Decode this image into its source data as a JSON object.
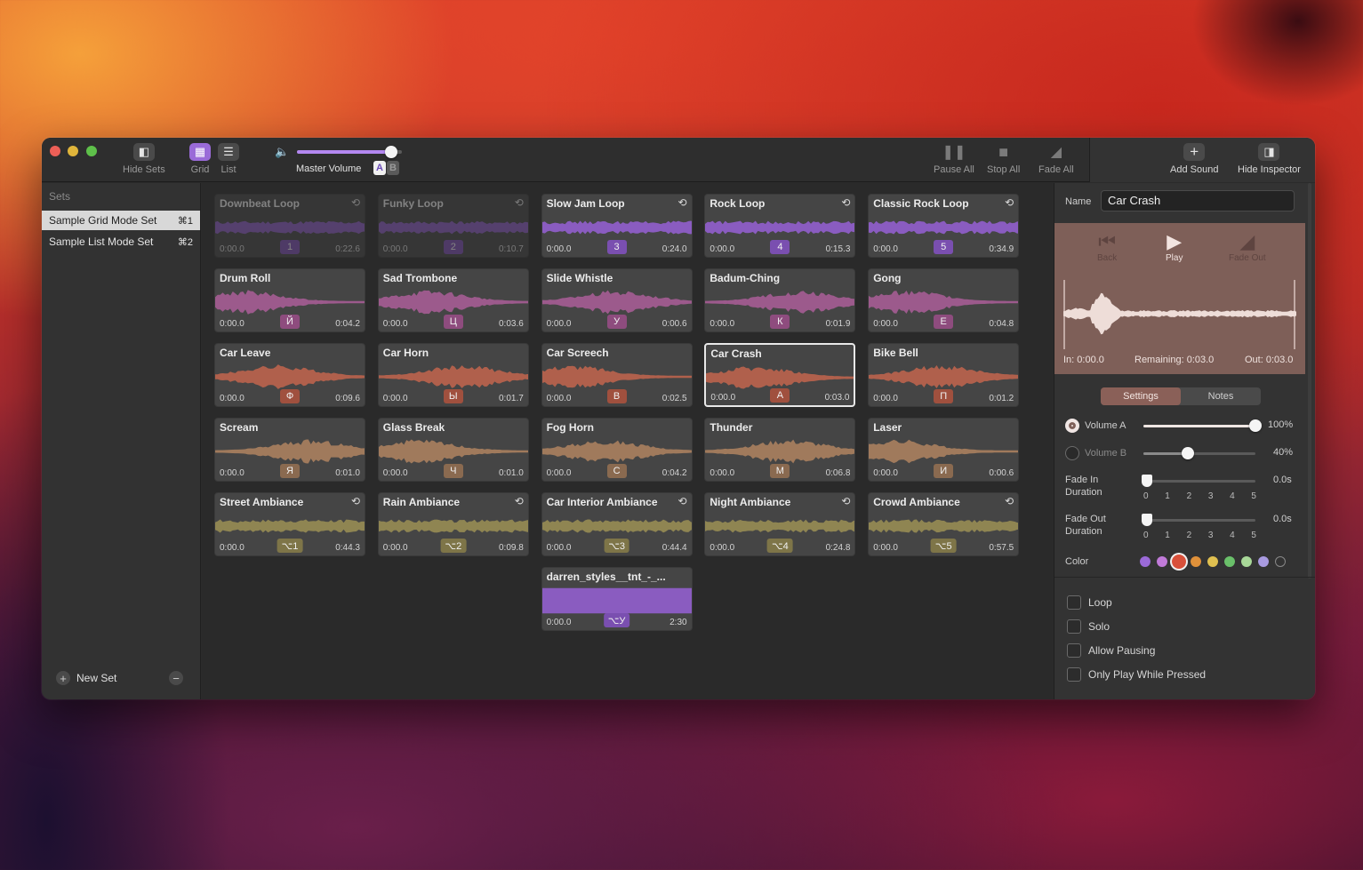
{
  "toolbar": {
    "hide_sets": "Hide Sets",
    "grid": "Grid",
    "list": "List",
    "master_volume": "Master Volume",
    "volume_level": 0.9,
    "ab_a": "A",
    "ab_b": "B",
    "pause_all": "Pause All",
    "stop_all": "Stop All",
    "fade_all": "Fade All",
    "add_sound": "Add Sound",
    "hide_inspector": "Hide Inspector"
  },
  "sidebar": {
    "heading": "Sets",
    "sets": [
      {
        "name": "Sample Grid Mode Set",
        "shortcut": "⌘1",
        "selected": true
      },
      {
        "name": "Sample List Mode Set",
        "shortcut": "⌘2",
        "selected": false
      }
    ],
    "new_set": "New Set"
  },
  "colors": {
    "purple": "#8a5cc0",
    "pink": "#9c5a8c",
    "salmon": "#b0604c",
    "tan": "#a07a5c",
    "olive": "#8f8552"
  },
  "tiles": [
    {
      "title": "Downbeat Loop",
      "key": "1",
      "start": "0:00.0",
      "end": "0:22.6",
      "loop": true,
      "color": "purple",
      "dim": true
    },
    {
      "title": "Funky Loop",
      "key": "2",
      "start": "0:00.0",
      "end": "0:10.7",
      "loop": true,
      "color": "purple",
      "dim": true
    },
    {
      "title": "Slow Jam Loop",
      "key": "3",
      "start": "0:00.0",
      "end": "0:24.0",
      "loop": true,
      "color": "purple"
    },
    {
      "title": "Rock Loop",
      "key": "4",
      "start": "0:00.0",
      "end": "0:15.3",
      "loop": true,
      "color": "purple"
    },
    {
      "title": "Classic Rock Loop",
      "key": "5",
      "start": "0:00.0",
      "end": "0:34.9",
      "loop": true,
      "color": "purple"
    },
    {
      "title": "Drum Roll",
      "key": "Й",
      "start": "0:00.0",
      "end": "0:04.2",
      "color": "pink"
    },
    {
      "title": "Sad Trombone",
      "key": "Ц",
      "start": "0:00.0",
      "end": "0:03.6",
      "color": "pink"
    },
    {
      "title": "Slide Whistle",
      "key": "У",
      "start": "0:00.0",
      "end": "0:00.6",
      "color": "pink"
    },
    {
      "title": "Badum-Ching",
      "key": "К",
      "start": "0:00.0",
      "end": "0:01.9",
      "color": "pink"
    },
    {
      "title": "Gong",
      "key": "Е",
      "start": "0:00.0",
      "end": "0:04.8",
      "color": "pink"
    },
    {
      "title": "Car Leave",
      "key": "Ф",
      "start": "0:00.0",
      "end": "0:09.6",
      "color": "salmon"
    },
    {
      "title": "Car Horn",
      "key": "Ы",
      "start": "0:00.0",
      "end": "0:01.7",
      "color": "salmon"
    },
    {
      "title": "Car Screech",
      "key": "В",
      "start": "0:00.0",
      "end": "0:02.5",
      "color": "salmon"
    },
    {
      "title": "Car Crash",
      "key": "А",
      "start": "0:00.0",
      "end": "0:03.0",
      "color": "salmon",
      "selected": true
    },
    {
      "title": "Bike Bell",
      "key": "П",
      "start": "0:00.0",
      "end": "0:01.2",
      "color": "salmon"
    },
    {
      "title": "Scream",
      "key": "Я",
      "start": "0:00.0",
      "end": "0:01.0",
      "color": "tan"
    },
    {
      "title": "Glass Break",
      "key": "Ч",
      "start": "0:00.0",
      "end": "0:01.0",
      "color": "tan"
    },
    {
      "title": "Fog Horn",
      "key": "С",
      "start": "0:00.0",
      "end": "0:04.2",
      "color": "tan"
    },
    {
      "title": "Thunder",
      "key": "М",
      "start": "0:00.0",
      "end": "0:06.8",
      "color": "tan"
    },
    {
      "title": "Laser",
      "key": "И",
      "start": "0:00.0",
      "end": "0:00.6",
      "color": "tan"
    },
    {
      "title": "Street Ambiance",
      "key": "⌥1",
      "start": "0:00.0",
      "end": "0:44.3",
      "loop": true,
      "color": "olive"
    },
    {
      "title": "Rain Ambiance",
      "key": "⌥2",
      "start": "0:00.0",
      "end": "0:09.8",
      "loop": true,
      "color": "olive"
    },
    {
      "title": "Car Interior Ambiance",
      "key": "⌥3",
      "start": "0:00.0",
      "end": "0:44.4",
      "loop": true,
      "color": "olive"
    },
    {
      "title": "Night Ambiance",
      "key": "⌥4",
      "start": "0:00.0",
      "end": "0:24.8",
      "loop": true,
      "color": "olive"
    },
    {
      "title": "Crowd Ambiance",
      "key": "⌥5",
      "start": "0:00.0",
      "end": "0:57.5",
      "loop": true,
      "color": "olive"
    },
    {
      "title": "darren_styles__tnt_-_...",
      "key": "⌥У",
      "start": "0:00.0",
      "end": "2:30",
      "color": "purple",
      "solid": true
    }
  ],
  "inspector": {
    "name_label": "Name",
    "name_value": "Car Crash",
    "back": "Back",
    "play": "Play",
    "fade_out": "Fade Out",
    "in": "In: 0:00.0",
    "remaining": "Remaining: 0:03.0",
    "out": "Out: 0:03.0",
    "tab_settings": "Settings",
    "tab_notes": "Notes",
    "volume_a": "Volume A",
    "volume_a_pct": "100%",
    "volume_a_level": 1.0,
    "volume_b": "Volume B",
    "volume_b_pct": "40%",
    "volume_b_level": 0.4,
    "fade_in": "Fade In Duration",
    "fade_in_value": "0.0s",
    "fade_out_dur": "Fade Out Duration",
    "fade_out_value": "0.0s",
    "ticks": [
      "0",
      "1",
      "2",
      "3",
      "4",
      "5"
    ],
    "color_label": "Color",
    "swatches": [
      "#9b6ad8",
      "#c07ad8",
      "#d8503a",
      "#e0913a",
      "#e0c050",
      "#6ac06a",
      "#a8d898",
      "#a89ae0",
      "none"
    ],
    "checks": [
      "Loop",
      "Solo",
      "Allow Pausing",
      "Only Play While Pressed"
    ]
  }
}
